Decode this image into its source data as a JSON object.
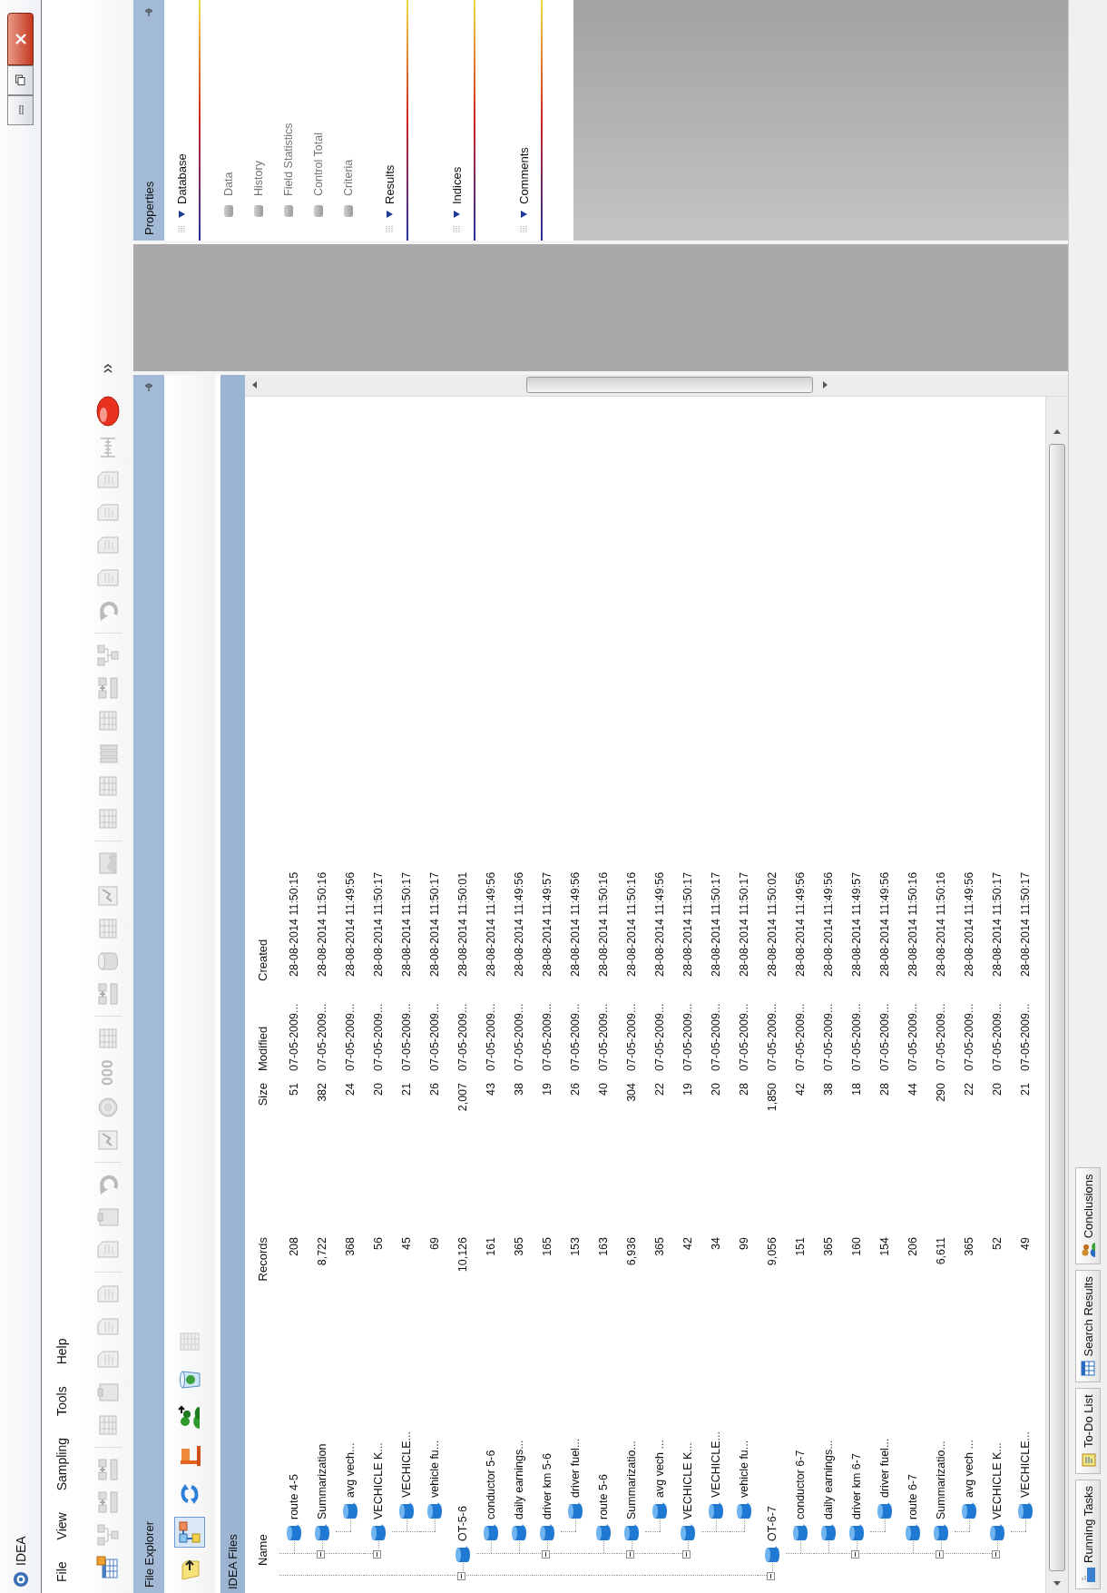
{
  "window": {
    "title": "IDEA"
  },
  "menu": [
    "File",
    "View",
    "Sampling",
    "Tools",
    "Help"
  ],
  "toolbar": [
    {
      "kind": "new-table"
    },
    {
      "kind": "tree"
    },
    {
      "kind": "join"
    },
    {
      "kind": "join"
    },
    {
      "kind": "separator"
    },
    {
      "kind": "table"
    },
    {
      "kind": "clipboard"
    },
    {
      "kind": "document"
    },
    {
      "kind": "document"
    },
    {
      "kind": "document"
    },
    {
      "kind": "separator"
    },
    {
      "kind": "document"
    },
    {
      "kind": "clipboard"
    },
    {
      "kind": "undo"
    },
    {
      "kind": "separator"
    },
    {
      "kind": "chart"
    },
    {
      "kind": "coin"
    },
    {
      "kind": "text",
      "label": "000"
    },
    {
      "kind": "table"
    },
    {
      "kind": "separator"
    },
    {
      "kind": "join"
    },
    {
      "kind": "database"
    },
    {
      "kind": "table"
    },
    {
      "kind": "chart"
    },
    {
      "kind": "image"
    },
    {
      "kind": "separator"
    },
    {
      "kind": "table"
    },
    {
      "kind": "table"
    },
    {
      "kind": "bars"
    },
    {
      "kind": "table"
    },
    {
      "kind": "join"
    },
    {
      "kind": "tree"
    },
    {
      "kind": "separator"
    },
    {
      "kind": "undo"
    },
    {
      "kind": "document"
    },
    {
      "kind": "document"
    },
    {
      "kind": "document"
    },
    {
      "kind": "document"
    },
    {
      "kind": "ruler"
    },
    {
      "kind": "record"
    }
  ],
  "explorer": {
    "title": "File Explorer",
    "tools": [
      {
        "kind": "note",
        "selected": false
      },
      {
        "kind": "tree",
        "selected": true
      },
      {
        "kind": "refresh",
        "selected": false
      },
      {
        "kind": "flag",
        "selected": false
      },
      {
        "kind": "people",
        "selected": false
      },
      {
        "kind": "recycle",
        "selected": false
      },
      {
        "kind": "grid",
        "selected": false
      }
    ],
    "folder": "IDEA Files",
    "columns": [
      "Name",
      "Records",
      "Size",
      "Modified",
      "Created"
    ],
    "tree": [
      {
        "children": [
          {
            "name": "route 4-5",
            "records": "208",
            "size": "51",
            "modified": "07-05-2009...",
            "created": "28-08-2014 11:50:15"
          },
          {
            "name": "Summarization",
            "records": "8,722",
            "size": "382",
            "modified": "07-05-2009...",
            "created": "28-08-2014 11:50:16",
            "expanded": true,
            "children": [
              {
                "name": "avg vech...",
                "records": "368",
                "size": "24",
                "modified": "07-05-2009...",
                "created": "28-08-2014 11:49:56"
              }
            ]
          },
          {
            "name": "VECHICLE K...",
            "records": "56",
            "size": "20",
            "modified": "07-05-2009...",
            "created": "28-08-2014 11:50:17",
            "expanded": true,
            "children": [
              {
                "name": "VECHICLE...",
                "records": "45",
                "size": "21",
                "modified": "07-05-2009...",
                "created": "28-08-2014 11:50:17"
              },
              {
                "name": "vehicle fu...",
                "records": "69",
                "size": "26",
                "modified": "07-05-2009...",
                "created": "28-08-2014 11:50:17"
              }
            ]
          }
        ]
      },
      {
        "name": "OT-5-6",
        "records": "10,126",
        "size": "2,007",
        "modified": "07-05-2009...",
        "created": "28-08-2014 11:50:01",
        "expanded": true,
        "children": [
          {
            "name": "conductor 5-6",
            "records": "161",
            "size": "43",
            "modified": "07-05-2009...",
            "created": "28-08-2014 11:49:56"
          },
          {
            "name": "daily earnings...",
            "records": "365",
            "size": "38",
            "modified": "07-05-2009...",
            "created": "28-08-2014 11:49:56"
          },
          {
            "name": "driver km 5-6",
            "records": "165",
            "size": "19",
            "modified": "07-05-2009...",
            "created": "28-08-2014 11:49:57",
            "expanded": true,
            "children": [
              {
                "name": "driver fuel...",
                "records": "153",
                "size": "26",
                "modified": "07-05-2009...",
                "created": "28-08-2014 11:49:56"
              }
            ]
          },
          {
            "name": "route 5-6",
            "records": "163",
            "size": "40",
            "modified": "07-05-2009...",
            "created": "28-08-2014 11:50:16"
          },
          {
            "name": "Summarizatio...",
            "records": "6,936",
            "size": "304",
            "modified": "07-05-2009...",
            "created": "28-08-2014 11:50:16",
            "expanded": true,
            "children": [
              {
                "name": "avg vech ...",
                "records": "365",
                "size": "22",
                "modified": "07-05-2009...",
                "created": "28-08-2014 11:49:56"
              }
            ]
          },
          {
            "name": "VECHICLE K...",
            "records": "42",
            "size": "19",
            "modified": "07-05-2009...",
            "created": "28-08-2014 11:50:17",
            "expanded": true,
            "children": [
              {
                "name": "VECHICLE...",
                "records": "34",
                "size": "20",
                "modified": "07-05-2009...",
                "created": "28-08-2014 11:50:17"
              },
              {
                "name": "vehicle fu...",
                "records": "99",
                "size": "28",
                "modified": "07-05-2009...",
                "created": "28-08-2014 11:50:17"
              }
            ]
          }
        ]
      },
      {
        "name": "OT-6-7",
        "records": "9,056",
        "size": "1,850",
        "modified": "07-05-2009...",
        "created": "28-08-2014 11:50:02",
        "expanded": true,
        "children": [
          {
            "name": "conductor 6-7",
            "records": "151",
            "size": "42",
            "modified": "07-05-2009...",
            "created": "28-08-2014 11:49:56"
          },
          {
            "name": "daily earnings...",
            "records": "365",
            "size": "38",
            "modified": "07-05-2009...",
            "created": "28-08-2014 11:49:56"
          },
          {
            "name": "driver km 6-7",
            "records": "160",
            "size": "18",
            "modified": "07-05-2009...",
            "created": "28-08-2014 11:49:57",
            "expanded": true,
            "children": [
              {
                "name": "driver fuel...",
                "records": "154",
                "size": "28",
                "modified": "07-05-2009...",
                "created": "28-08-2014 11:49:56"
              }
            ]
          },
          {
            "name": "route 6-7",
            "records": "206",
            "size": "44",
            "modified": "07-05-2009...",
            "created": "28-08-2014 11:50:16"
          },
          {
            "name": "Summarizatio...",
            "records": "6,611",
            "size": "290",
            "modified": "07-05-2009...",
            "created": "28-08-2014 11:50:16",
            "expanded": true,
            "children": [
              {
                "name": "avg vech ...",
                "records": "365",
                "size": "22",
                "modified": "07-05-2009...",
                "created": "28-08-2014 11:49:56"
              }
            ]
          },
          {
            "name": "VECHICLE K...",
            "records": "52",
            "size": "20",
            "modified": "07-05-2009...",
            "created": "28-08-2014 11:50:17",
            "expanded": true,
            "children": [
              {
                "name": "VECHICLE...",
                "records": "49",
                "size": "21",
                "modified": "07-05-2009...",
                "created": "28-08-2014 11:50:17"
              }
            ]
          }
        ]
      }
    ]
  },
  "properties": {
    "title": "Properties",
    "sections": [
      {
        "title": "Database",
        "expanded": true,
        "items": [
          "Data",
          "History",
          "Field Statistics",
          "Control Total",
          "Criteria"
        ]
      },
      {
        "title": "Results",
        "expanded": true
      },
      {
        "title": "Indices",
        "expanded": true
      },
      {
        "title": "Comments",
        "expanded": true
      }
    ]
  },
  "bottom_tabs": [
    {
      "kind": "tasks",
      "label": "Running Tasks"
    },
    {
      "kind": "todo",
      "label": "To-Do List"
    },
    {
      "kind": "search",
      "label": "Search Results"
    },
    {
      "kind": "notes",
      "label": "Conclusions"
    }
  ]
}
